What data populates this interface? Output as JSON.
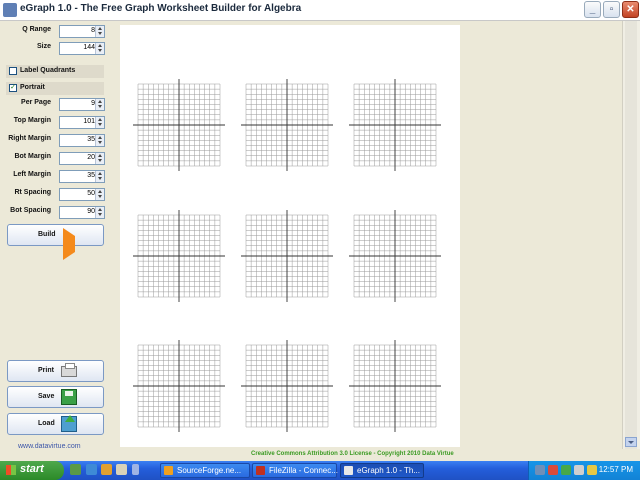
{
  "window": {
    "title": "eGraph 1.0 - The Free Graph Worksheet Builder for Algebra"
  },
  "controls": {
    "q_range": {
      "label": "Q Range",
      "value": "8"
    },
    "size": {
      "label": "Size",
      "value": "144"
    },
    "label_quadrants": {
      "label": "Label Quadrants",
      "checked": false
    },
    "portrait": {
      "label": "Portrait",
      "checked": true
    },
    "per_page": {
      "label": "Per Page",
      "value": "9"
    },
    "top_margin": {
      "label": "Top Margin",
      "value": "101"
    },
    "right_margin": {
      "label": "Right Margin",
      "value": "35"
    },
    "bot_margin": {
      "label": "Bot Margin",
      "value": "20"
    },
    "left_margin": {
      "label": "Left Margin",
      "value": "35"
    },
    "rt_spacing": {
      "label": "Rt Spacing",
      "value": "50"
    },
    "bot_spacing": {
      "label": "Bot Spacing",
      "value": "90"
    }
  },
  "buttons": {
    "build": "Build",
    "print": "Print",
    "save": "Save",
    "load": "Load"
  },
  "link": "www.datavirtue.com",
  "footer": "Creative Commons Attribution 3.0 License - Copyright 2010 Data Virtue",
  "preview": {
    "graph_count": 9,
    "grid_lines_per_axis": 17
  },
  "taskbar": {
    "start": "start",
    "tasks": [
      "SourceForge.ne...",
      "FileZilla - Connec...",
      "eGraph 1.0 - Th..."
    ],
    "clock": "12:57 PM"
  },
  "colors": {
    "footer": "#3a9a22",
    "link": "#3c56a8",
    "build_icon": "#f48a1c"
  }
}
